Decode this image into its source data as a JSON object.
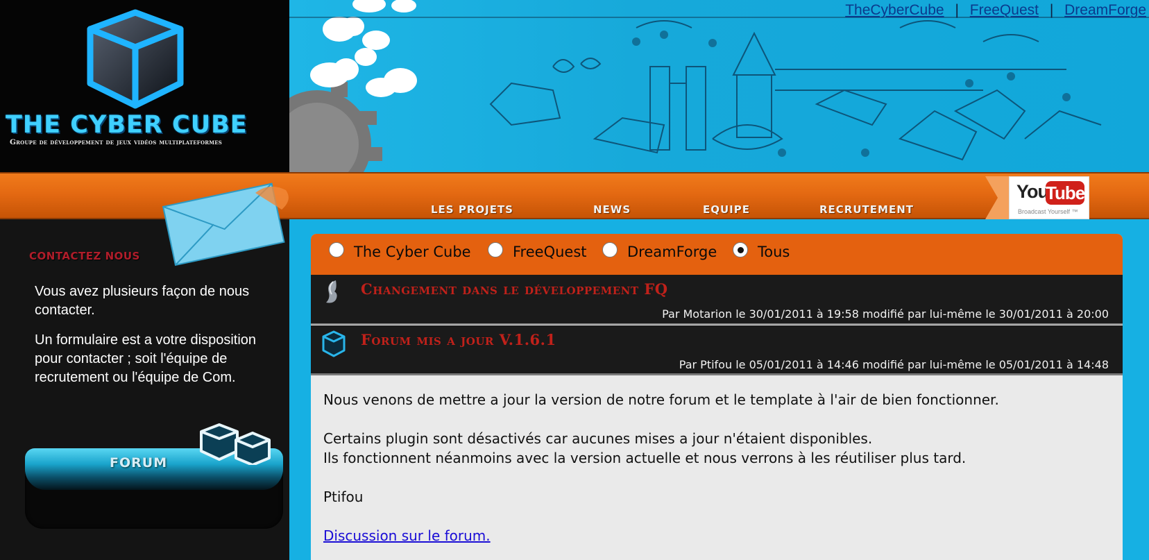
{
  "header": {
    "logo_title": "THE CYBER CUBE",
    "logo_subtitle": "Groupe de développement de jeux vidéos multiplateformes",
    "top_links": [
      "TheCyberCube",
      "FreeQuest",
      "DreamForge"
    ],
    "top_link_separator": "|"
  },
  "nav": {
    "items": [
      "LES PROJETS",
      "NEWS",
      "EQUIPE",
      "RECRUTEMENT"
    ],
    "youtube": {
      "you": "You",
      "tube": "Tube",
      "slogan": "Broadcast Yourself ™"
    }
  },
  "sidebar": {
    "contact_title": "CONTACTEZ NOUS",
    "contact_p1": "Vous avez plusieurs façon de nous contacter.",
    "contact_p2": "Un formulaire est a votre disposition pour contacter ; soit l'équipe de recrutement ou l'équipe de Com.",
    "forum_label": "FORUM"
  },
  "filter": {
    "options": [
      {
        "label": "The Cyber Cube",
        "checked": false
      },
      {
        "label": "FreeQuest",
        "checked": false
      },
      {
        "label": "DreamForge",
        "checked": false
      },
      {
        "label": "Tous",
        "checked": true
      }
    ]
  },
  "posts": [
    {
      "title": "Changement dans le développement FQ",
      "meta": "Par Motarion le 30/01/2011 à 19:58 modifié par lui-même le 30/01/2011 à 20:00",
      "icon": "freequest-icon"
    },
    {
      "title": "Forum mis a jour V.1.6.1",
      "meta": "Par Ptifou le 05/01/2011 à 14:46 modifié par lui-même le 05/01/2011 à 14:48",
      "icon": "cube-icon"
    }
  ],
  "post_body": {
    "line1": "Nous venons de mettre a jour la version de notre forum et le template à l'air de bien fonctionner.",
    "line2": "Certains plugin sont désactivés car aucunes mises a jour n'étaient disponibles.",
    "line3": "Ils fonctionnent néanmoins avec la version actuelle et nous verrons à les réutiliser plus tard.",
    "signature": "Ptifou",
    "link": "Discussion sur le forum."
  },
  "colors": {
    "background": "#16b0e3",
    "nav_orange": "#e46912",
    "sidebar": "#141414",
    "post_title_red": "#c0211a",
    "panel": "#eaeaea"
  }
}
